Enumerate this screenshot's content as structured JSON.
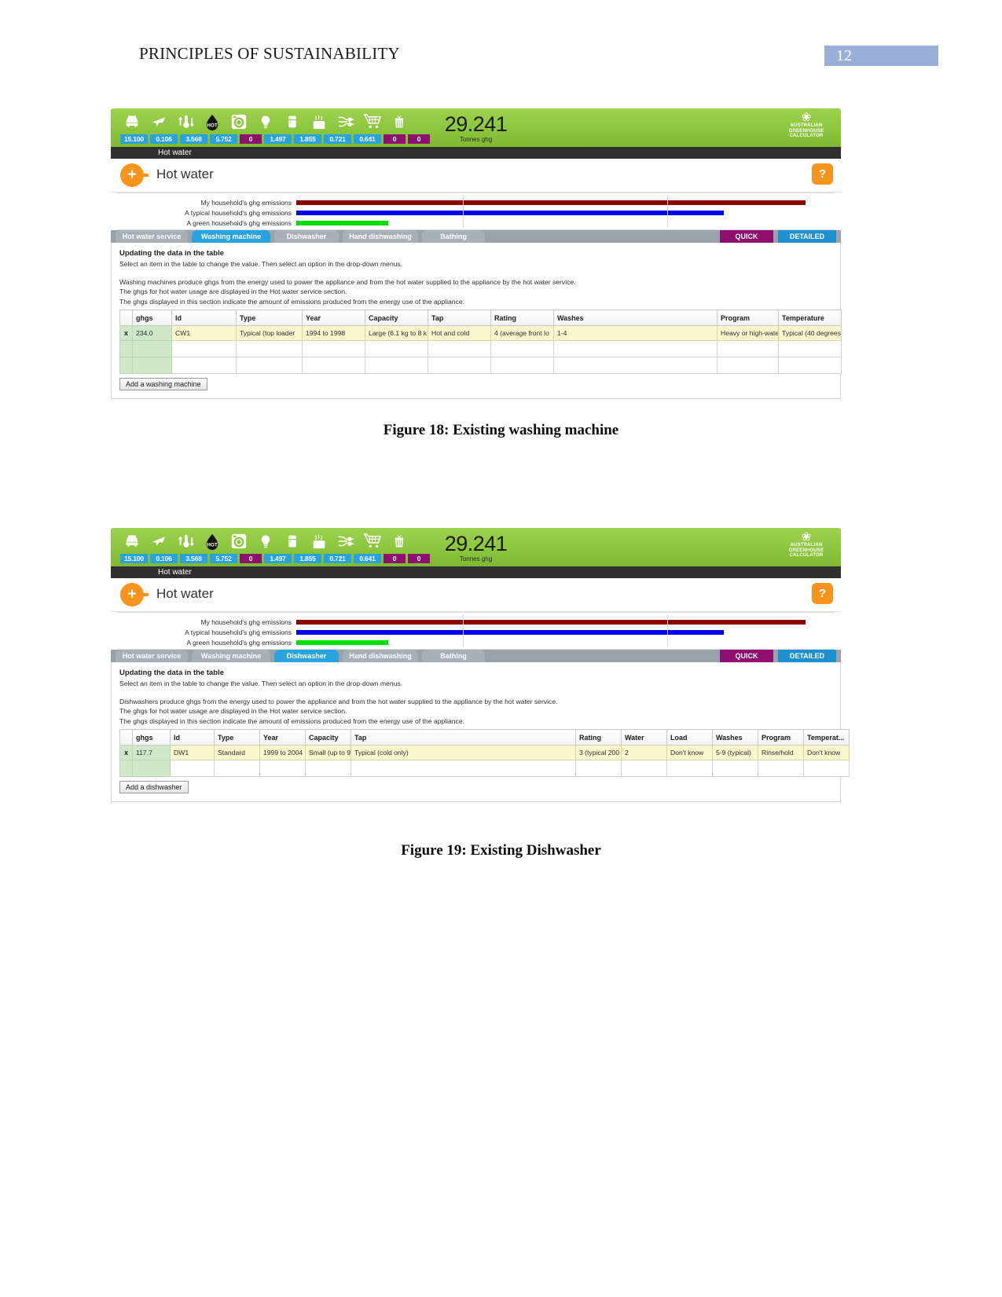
{
  "document": {
    "header_title": "PRINCIPLES OF SUSTAINABILITY",
    "page_number": "12"
  },
  "calculator": {
    "total_value": "29.241",
    "total_unit": "Tonnes ghg",
    "strip_label": "Hot water",
    "section_title": "Hot water",
    "plus_label": "+",
    "help_label": "?",
    "logo": {
      "leaf_glyph": "❀",
      "line1": "AUSTRALIAN",
      "line2": "GREENHOUSE",
      "line3": "CALCULATOR"
    },
    "icons": [
      {
        "name": "car-icon",
        "value": "15.100"
      },
      {
        "name": "plane-icon",
        "value": "0.106"
      },
      {
        "name": "thermostat-icon",
        "value": "3.568"
      },
      {
        "name": "hot-water-drop-icon",
        "value": "5.752"
      },
      {
        "name": "washing-machine-icon",
        "value": "0"
      },
      {
        "name": "light-bulb-icon",
        "value": "1.497"
      },
      {
        "name": "fridge-icon",
        "value": "1.855"
      },
      {
        "name": "cooktop-icon",
        "value": "0.721"
      },
      {
        "name": "appliances-plug-icon",
        "value": "0.641"
      },
      {
        "name": "shopping-trolley-icon",
        "value": "0"
      },
      {
        "name": "waste-bin-icon",
        "value": "0"
      }
    ],
    "chart": {
      "rows": [
        {
          "label": "My household's ghg emissions",
          "color": "#8b0000",
          "pct": 100
        },
        {
          "label": "A typical household's ghg emissions",
          "color": "#0000ee",
          "pct": 84
        },
        {
          "label": "A green household's ghg emissions",
          "color": "#00e000",
          "pct": 18
        }
      ]
    },
    "tabs": [
      {
        "label": "Hot water service",
        "state": "inactive"
      },
      {
        "label": "Washing machine",
        "state": "active"
      },
      {
        "label": "Dishwasher",
        "state": "inactive"
      },
      {
        "label": "Hand dishwashing",
        "state": "inactive"
      },
      {
        "label": "Bathing",
        "state": "inactive"
      }
    ],
    "mode_tabs": [
      {
        "label": "QUICK",
        "state": "quick"
      },
      {
        "label": "DETAILED",
        "state": "detailed"
      }
    ]
  },
  "figure18": {
    "caption": "Figure 18: Existing washing machine",
    "instruction_bold": "Updating the data in the table",
    "instruction_sub": "Select an item in the table to change the value. Then select an option in the drop-down menus.",
    "notes": [
      "Washing machines produce ghgs from the energy  used to power the appliance and from the hot water supplied to the appliance by the hot water service.",
      "The ghgs for hot water usage are displayed in the Hot water service section.",
      "The ghgs displayed in this section indicate the amount of emissions produced from the energy use of the appliance."
    ],
    "table": {
      "headers": [
        "",
        "ghgs",
        "Id",
        "Type",
        "Year",
        "Capacity",
        "Tap",
        "Rating",
        "Washes",
        "Program",
        "Temperature"
      ],
      "rows": [
        [
          "x",
          "234.0",
          "CW1",
          "Typical (top loader",
          "1994 to 1998",
          "Large (6.1 kg to 8 k",
          "Hot and cold",
          "4 (average front lo",
          "1-4",
          "Heavy or high-wate",
          "Typical (40 degrees"
        ]
      ]
    },
    "add_button": "Add a washing machine"
  },
  "figure19": {
    "caption": "Figure 19: Existing Dishwasher",
    "instruction_bold": "Updating the data in the table",
    "instruction_sub": "Select an item in the table to change the value. Then select an option in the drop-down menus.",
    "notes": [
      "Dishwashers produce ghgs from the energy used to power the appliance and from  the hot water supplied to the appliance by the hot water service.",
      "The ghgs for hot water usage are displayed in the Hot water service section.",
      "The ghgs displayed in this section indicate the amount of emissions produced from the energy use of the appliance."
    ],
    "tabs": [
      {
        "label": "Hot water service",
        "state": "inactive"
      },
      {
        "label": "Washing machine",
        "state": "inactive"
      },
      {
        "label": "Dishwasher",
        "state": "active"
      },
      {
        "label": "Hand dishwashing",
        "state": "inactive"
      },
      {
        "label": "Bathing",
        "state": "inactive"
      }
    ],
    "table": {
      "headers": [
        "",
        "ghgs",
        "Id",
        "Type",
        "Year",
        "Capacity",
        "Tap",
        "Rating",
        "Water",
        "Load",
        "Washes",
        "Program",
        "Temperat..."
      ],
      "rows": [
        [
          "x",
          "117.7",
          "DW1",
          "Standard",
          "1999 to 2004",
          "Small (up to 9",
          "Typical (cold only)",
          "3 (typical 200",
          "2",
          "Don't know",
          "5-9 (typical)",
          "Rinse/hold",
          "Don't know"
        ]
      ]
    },
    "add_button": "Add a dishwasher"
  }
}
